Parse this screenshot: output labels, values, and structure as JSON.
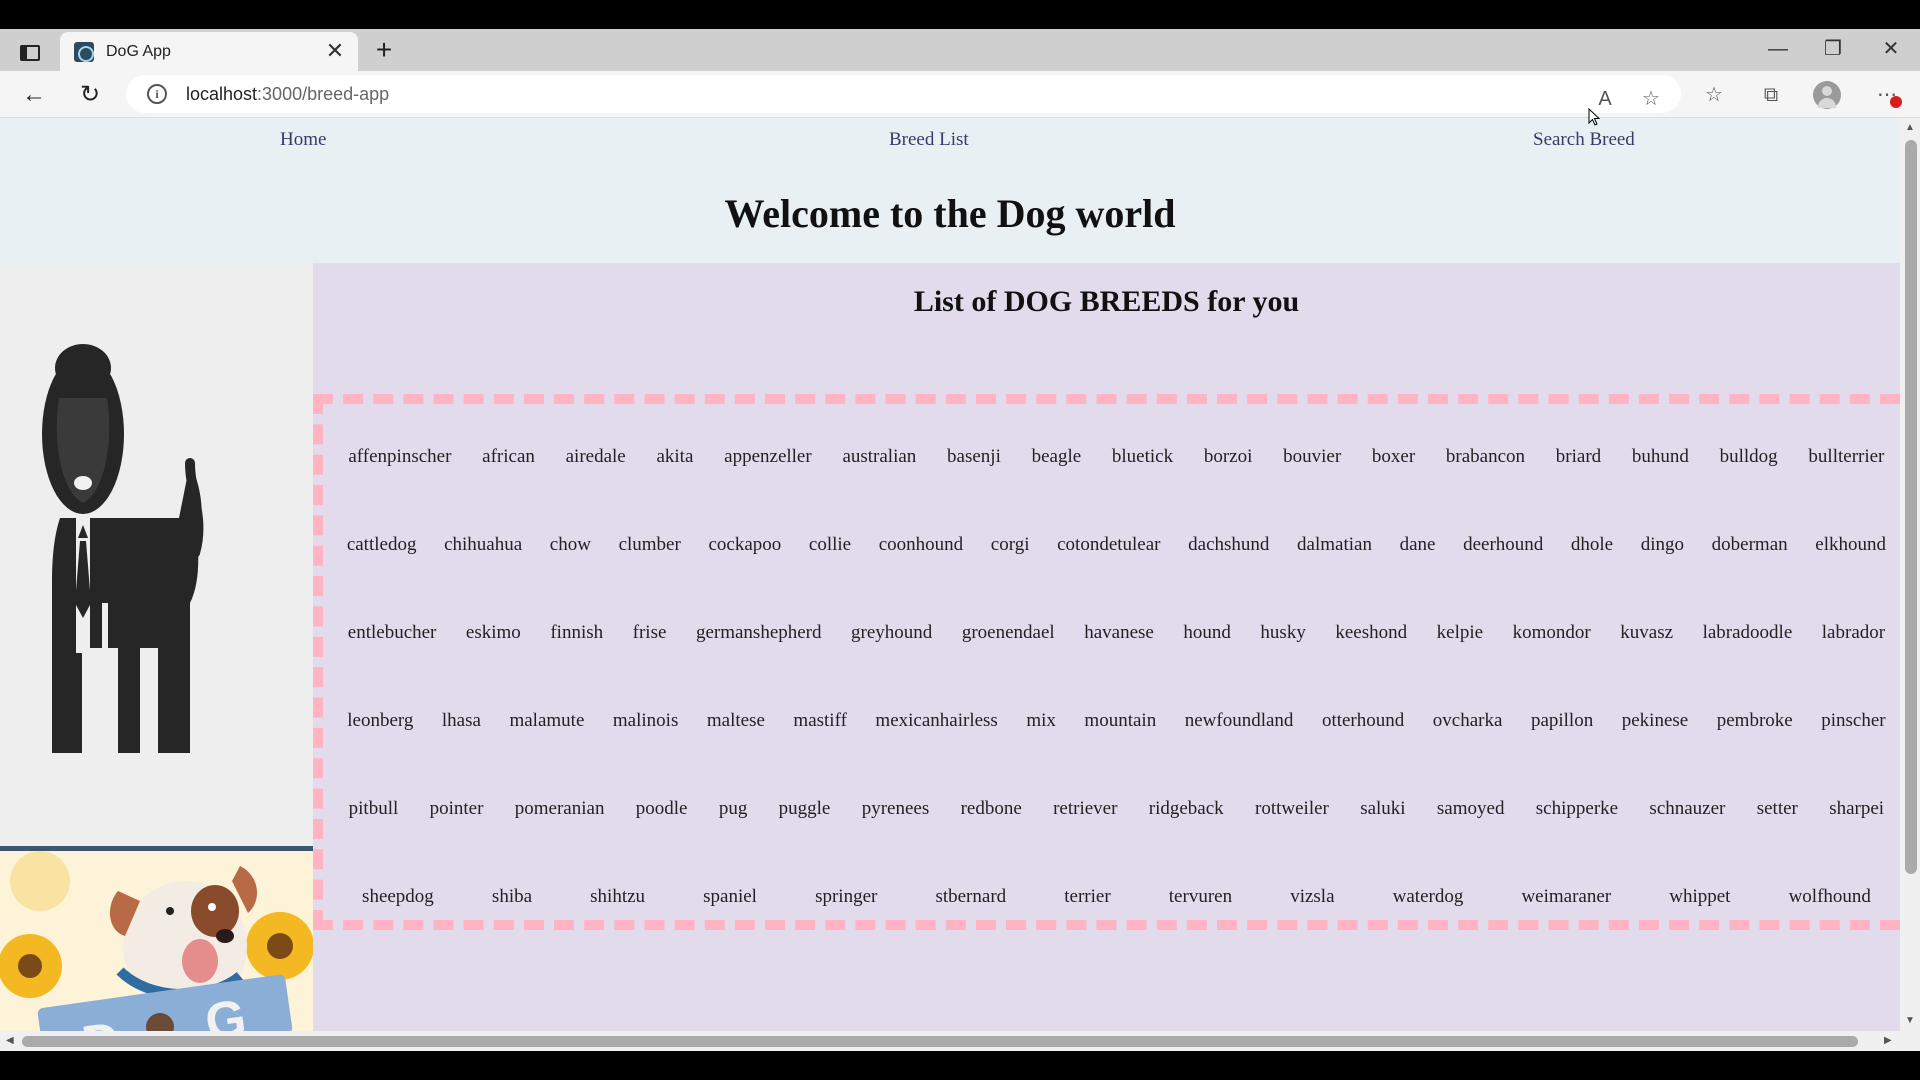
{
  "browser": {
    "tab_title": "DoG App",
    "url_host": "localhost",
    "url_path": ":3000/breed-app",
    "close_glyph": "✕",
    "new_tab_glyph": "+",
    "minimize_glyph": "—",
    "maximize_glyph": "❐",
    "close_window_glyph": "✕",
    "back_glyph": "←",
    "reload_glyph": "↻",
    "read_aloud_glyph": "A",
    "fav_add_glyph": "☆",
    "favorites_glyph": "☆",
    "collections_glyph": "⧉",
    "menu_glyph": "⋯"
  },
  "nav": {
    "home": "Home",
    "breed_list": "Breed List",
    "search_breed": "Search Breed"
  },
  "page": {
    "welcome": "Welcome to the Dog world",
    "list_title": "List of DOG BREEDS for you"
  },
  "breeds": [
    [
      "affenpinscher",
      "african",
      "airedale",
      "akita",
      "appenzeller",
      "australian",
      "basenji",
      "beagle",
      "bluetick",
      "borzoi",
      "bouvier",
      "boxer",
      "brabancon",
      "briard",
      "buhund",
      "bulldog",
      "bullterrier"
    ],
    [
      "cattledog",
      "chihuahua",
      "chow",
      "clumber",
      "cockapoo",
      "collie",
      "coonhound",
      "corgi",
      "cotondetulear",
      "dachshund",
      "dalmatian",
      "dane",
      "deerhound",
      "dhole",
      "dingo",
      "doberman",
      "elkhound"
    ],
    [
      "entlebucher",
      "eskimo",
      "finnish",
      "frise",
      "germanshepherd",
      "greyhound",
      "groenendael",
      "havanese",
      "hound",
      "husky",
      "keeshond",
      "kelpie",
      "komondor",
      "kuvasz",
      "labradoodle",
      "labrador"
    ],
    [
      "leonberg",
      "lhasa",
      "malamute",
      "malinois",
      "maltese",
      "mastiff",
      "mexicanhairless",
      "mix",
      "mountain",
      "newfoundland",
      "otterhound",
      "ovcharka",
      "papillon",
      "pekinese",
      "pembroke",
      "pinscher"
    ],
    [
      "pitbull",
      "pointer",
      "pomeranian",
      "poodle",
      "pug",
      "puggle",
      "pyrenees",
      "redbone",
      "retriever",
      "ridgeback",
      "rottweiler",
      "saluki",
      "samoyed",
      "schipperke",
      "schnauzer",
      "setter",
      "sharpei"
    ],
    [
      "sheepdog",
      "shiba",
      "shihtzu",
      "spaniel",
      "springer",
      "stbernard",
      "terrier",
      "tervuren",
      "vizsla",
      "waterdog",
      "weimaraner",
      "whippet",
      "wolfhound"
    ]
  ],
  "images": {
    "logo_icon": "dog-logo-icon",
    "photo_icon": "dog-illustration",
    "photo_letters": "DOG"
  },
  "colors": {
    "nav_bg": "#e8f0f3",
    "main_bg": "#e1dbec",
    "dash_border": "#ffb3c3",
    "divider": "#3c5670"
  }
}
